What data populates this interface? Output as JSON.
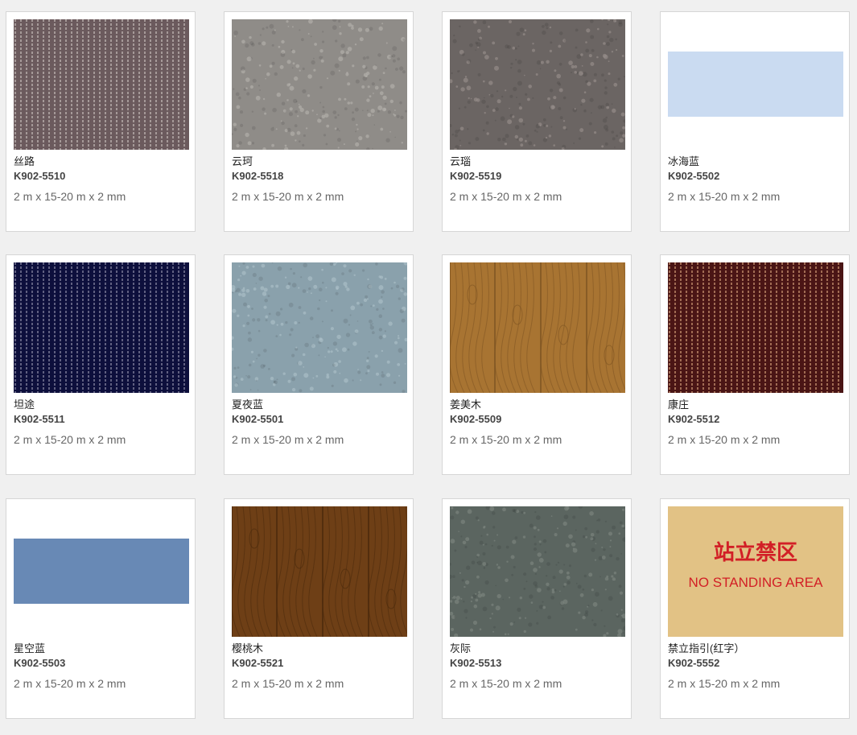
{
  "products": [
    {
      "name": "丝路",
      "code": "K902-5510",
      "size": "2 m x 15-20 m x 2 mm",
      "pattern": "stripes",
      "base": "#6b5a5d",
      "accent": "#b0a4a3",
      "icon": "stripe-carpet-swatch"
    },
    {
      "name": "云珂",
      "code": "K902-5518",
      "size": "2 m x 15-20 m x 2 mm",
      "pattern": "speckle",
      "base": "#8f8c88",
      "accent": "#b1aea9",
      "icon": "speckle-swatch"
    },
    {
      "name": "云瑙",
      "code": "K902-5519",
      "size": "2 m x 15-20 m x 2 mm",
      "pattern": "speckle",
      "base": "#6b6563",
      "accent": "#948c89",
      "icon": "speckle-swatch"
    },
    {
      "name": "冰海蓝",
      "code": "K902-5502",
      "size": "2 m x 15-20 m x 2 mm",
      "pattern": "solid-short",
      "base": "#c6d8f0",
      "accent": "#d6e3f5",
      "icon": "solid-swatch"
    },
    {
      "name": "坦途",
      "code": "K902-5511",
      "size": "2 m x 15-20 m x 2 mm",
      "pattern": "stripes",
      "base": "#0d0f3c",
      "accent": "#6e6d8c",
      "icon": "stripe-carpet-swatch"
    },
    {
      "name": "夏夜蓝",
      "code": "K902-5501",
      "size": "2 m x 15-20 m x 2 mm",
      "pattern": "speckle",
      "base": "#8aa1ac",
      "accent": "#a9bdc6",
      "icon": "speckle-swatch"
    },
    {
      "name": "姜美木",
      "code": "K902-5509",
      "size": "2 m x 15-20 m x 2 mm",
      "pattern": "wood",
      "base": "#a87432",
      "accent": "#7d5422",
      "icon": "wood-swatch"
    },
    {
      "name": "康庄",
      "code": "K902-5512",
      "size": "2 m x 15-20 m x 2 mm",
      "pattern": "stripes",
      "base": "#4a1515",
      "accent": "#b07a5e",
      "icon": "stripe-carpet-swatch"
    },
    {
      "name": "星空蓝",
      "code": "K902-5503",
      "size": "2 m x 15-20 m x 2 mm",
      "pattern": "solid-short",
      "base": "#6586b3",
      "accent": "#7593bd",
      "icon": "solid-swatch"
    },
    {
      "name": "樱桃木",
      "code": "K902-5521",
      "size": "2 m x 15-20 m x 2 mm",
      "pattern": "wood",
      "base": "#6e3f16",
      "accent": "#4a290c",
      "icon": "wood-swatch"
    },
    {
      "name": "灰际",
      "code": "K902-5513",
      "size": "2 m x 15-20 m x 2 mm",
      "pattern": "speckle",
      "base": "#5b6560",
      "accent": "#7a837e",
      "icon": "speckle-swatch"
    },
    {
      "name": "禁立指引(红字）",
      "code": "K902-5552",
      "size": "2 m x 15-20 m x 2 mm",
      "pattern": "sign",
      "base": "#e2c285",
      "accent": "#d21f26",
      "icon": "no-standing-sign-swatch",
      "sign_cn": "站立禁区",
      "sign_en": "NO STANDING AREA"
    }
  ]
}
